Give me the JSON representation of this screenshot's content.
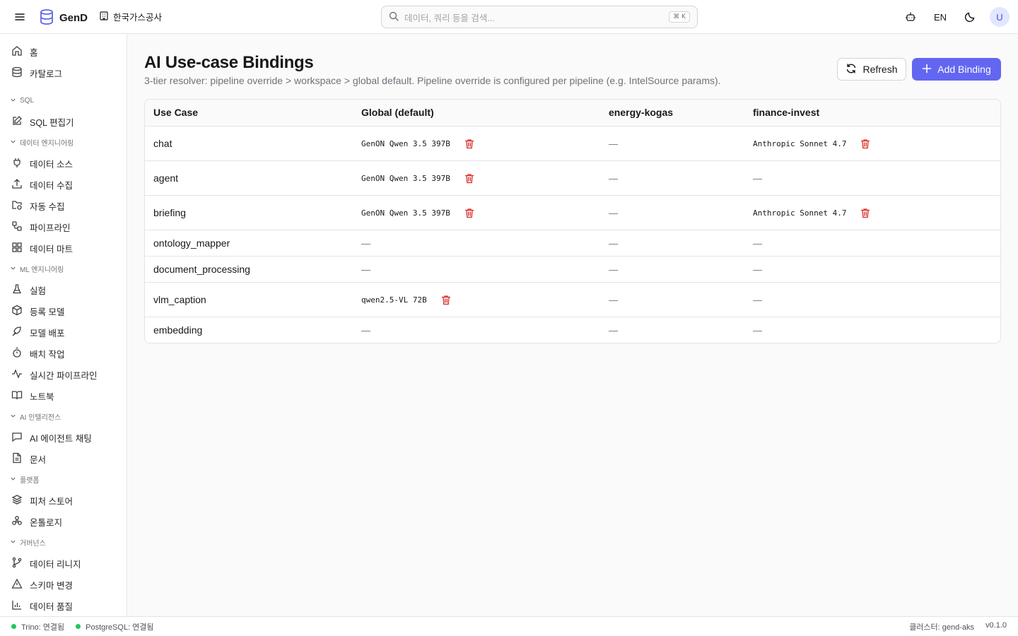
{
  "header": {
    "brand": "GenD",
    "org": "한국가스공사",
    "search_placeholder": "데이터, 쿼리 등을 검색...",
    "search_shortcut": "⌘ K",
    "lang": "EN",
    "avatar": "U",
    "icons": [
      "menu-icon",
      "database-logo-icon",
      "building-icon",
      "search-icon",
      "bot-icon",
      "moon-icon"
    ]
  },
  "sidebar": {
    "top": [
      {
        "label": "홈",
        "icon": "home-icon"
      },
      {
        "label": "카탈로그",
        "icon": "database-icon"
      }
    ],
    "sections": [
      {
        "title": "SQL",
        "items": [
          {
            "label": "SQL 편집기",
            "icon": "edit-icon"
          }
        ]
      },
      {
        "title": "데이터 엔지니어링",
        "items": [
          {
            "label": "데이터 소스",
            "icon": "plug-icon"
          },
          {
            "label": "데이터 수집",
            "icon": "upload-icon"
          },
          {
            "label": "자동 수집",
            "icon": "folder-sync-icon"
          },
          {
            "label": "파이프라인",
            "icon": "workflow-icon"
          },
          {
            "label": "데이터 마트",
            "icon": "grid-icon"
          }
        ]
      },
      {
        "title": "ML 엔지니어링",
        "items": [
          {
            "label": "실험",
            "icon": "flask-icon"
          },
          {
            "label": "등록 모델",
            "icon": "package-icon"
          },
          {
            "label": "모델 배포",
            "icon": "rocket-icon"
          },
          {
            "label": "배치 작업",
            "icon": "timer-icon"
          },
          {
            "label": "실시간 파이프라인",
            "icon": "activity-icon"
          },
          {
            "label": "노트북",
            "icon": "book-icon"
          }
        ]
      },
      {
        "title": "AI 인텔리전스",
        "items": [
          {
            "label": "AI 에이전트 채팅",
            "icon": "chat-icon"
          },
          {
            "label": "문서",
            "icon": "document-icon"
          }
        ]
      },
      {
        "title": "플랫폼",
        "items": [
          {
            "label": "피처 스토어",
            "icon": "layers-icon"
          },
          {
            "label": "온톨로지",
            "icon": "ontology-icon"
          }
        ]
      },
      {
        "title": "거버넌스",
        "items": [
          {
            "label": "데이터 리니지",
            "icon": "git-branch-icon"
          },
          {
            "label": "스키마 변경",
            "icon": "warning-icon"
          },
          {
            "label": "데이터 품질",
            "icon": "bar-chart-icon"
          }
        ]
      }
    ]
  },
  "main": {
    "title": "AI Use-case Bindings",
    "subtitle": "3-tier resolver: pipeline override > workspace > global default. Pipeline override is configured per pipeline (e.g. IntelSource params).",
    "refresh_label": "Refresh",
    "add_label": "Add Binding",
    "table": {
      "columns": [
        "Use Case",
        "Global (default)",
        "energy-kogas",
        "finance-invest"
      ],
      "empty": "—",
      "rows": [
        {
          "use_case": "chat",
          "cells": [
            "GenON Qwen 3.5 397B",
            null,
            "Anthropic Sonnet 4.7"
          ]
        },
        {
          "use_case": "agent",
          "cells": [
            "GenON Qwen 3.5 397B",
            null,
            null
          ]
        },
        {
          "use_case": "briefing",
          "cells": [
            "GenON Qwen 3.5 397B",
            null,
            "Anthropic Sonnet 4.7"
          ]
        },
        {
          "use_case": "ontology_mapper",
          "cells": [
            null,
            null,
            null
          ]
        },
        {
          "use_case": "document_processing",
          "cells": [
            null,
            null,
            null
          ]
        },
        {
          "use_case": "vlm_caption",
          "cells": [
            "qwen2.5-VL 72B",
            null,
            null
          ]
        },
        {
          "use_case": "embedding",
          "cells": [
            null,
            null,
            null
          ]
        }
      ]
    }
  },
  "statusbar": {
    "trino": "Trino: 연결됨",
    "postgres": "PostgreSQL: 연결됨",
    "cluster": "클러스터: gend-aks",
    "version": "v0.1.0",
    "status_color": "#22c55e"
  },
  "colors": {
    "accent": "#6366f1",
    "danger": "#dc2626"
  }
}
